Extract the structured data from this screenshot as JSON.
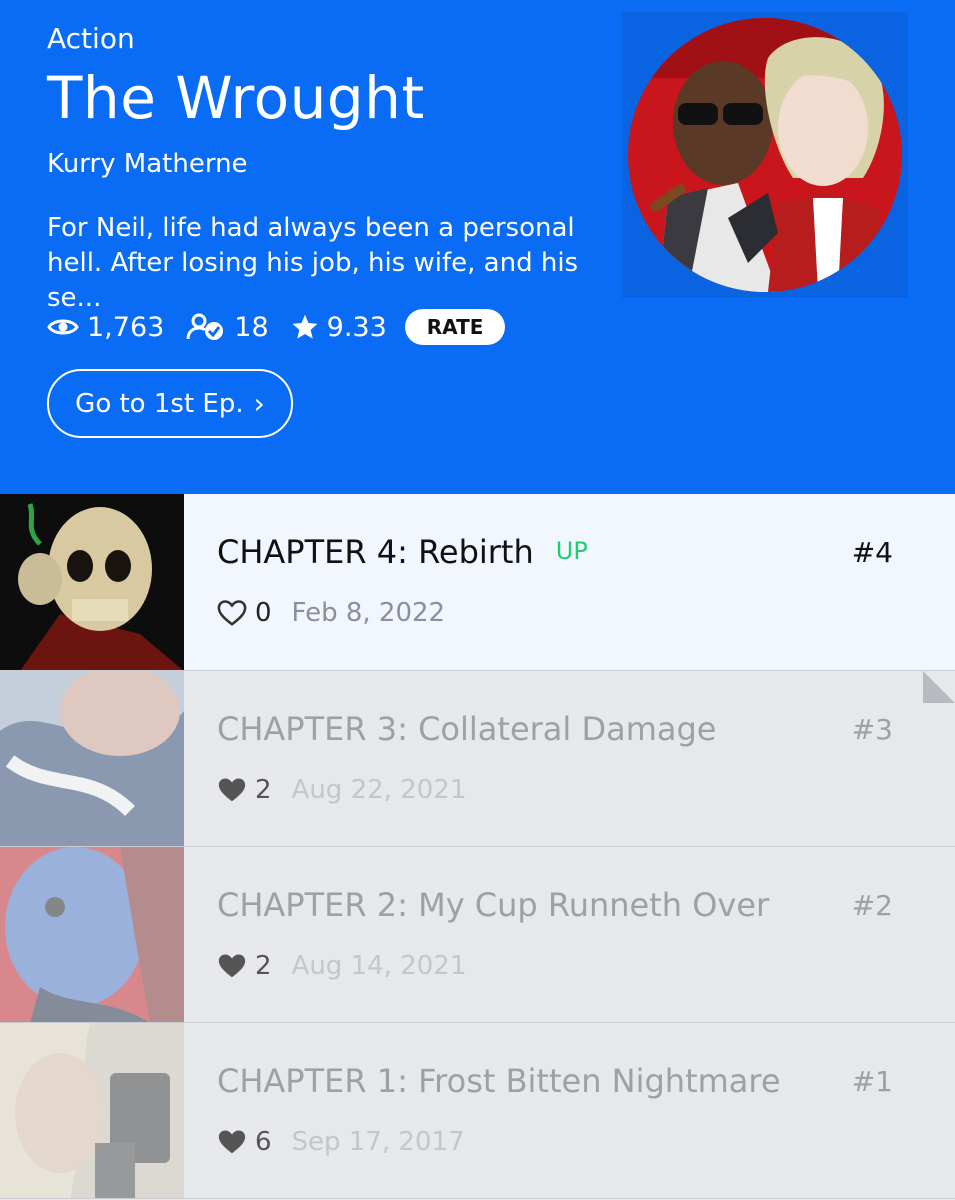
{
  "series": {
    "genre": "Action",
    "title": "The Wrought",
    "author": "Kurry Matherne",
    "synopsis": "For Neil, life had always been a personal hell. After losing his job, his wife, and his se...",
    "views": "1,763",
    "subscribers": "18",
    "rating": "9.33",
    "rate_label": "RATE",
    "first_ep_label": "Go to 1st Ep.",
    "first_ep_chevron": "›"
  },
  "colors": {
    "header_bg": "#0a6cf5",
    "up_badge": "#1fcf6b",
    "current_row_bg": "#f1f6ff",
    "read_row_bg": "#e6e8eb"
  },
  "icons": {
    "views": "eye-icon",
    "subscribers": "subscriber-icon",
    "rating": "star-icon",
    "like_unread": "heart-outline-icon",
    "like_read": "heart-filled-icon"
  },
  "episodes": [
    {
      "title": "CHAPTER 4: Rebirth",
      "badge": "UP",
      "number": "#4",
      "likes": "0",
      "date": "Feb 8, 2022",
      "read": false
    },
    {
      "title": "CHAPTER 3: Collateral Damage",
      "number": "#3",
      "likes": "2",
      "date": "Aug 22, 2021",
      "read": true
    },
    {
      "title": "CHAPTER 2: My Cup Runneth Over",
      "number": "#2",
      "likes": "2",
      "date": "Aug 14, 2021",
      "read": true
    },
    {
      "title": "CHAPTER 1: Frost Bitten Nightmare",
      "number": "#1",
      "likes": "6",
      "date": "Sep 17, 2017",
      "read": true
    }
  ]
}
